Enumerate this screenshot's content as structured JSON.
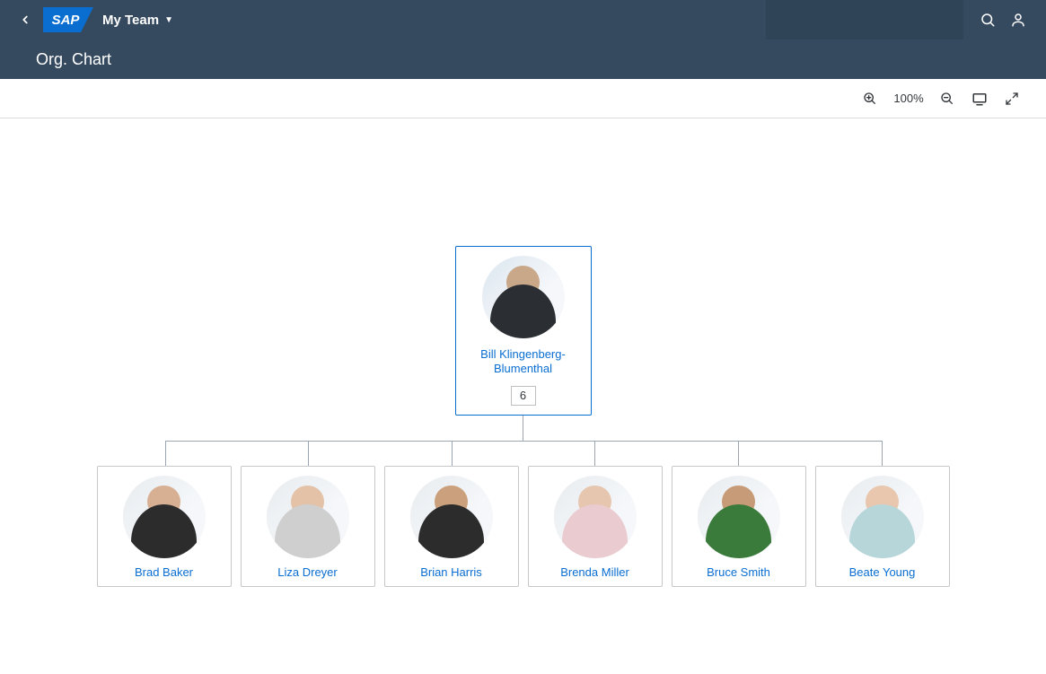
{
  "shell": {
    "logo_text": "SAP",
    "menu_label": "My Team"
  },
  "page": {
    "title": "Org. Chart"
  },
  "toolbar": {
    "zoom_level": "100%"
  },
  "org": {
    "manager": {
      "name": "Bill Klingenberg-Blumenthal",
      "direct_reports_count": "6"
    },
    "reports": [
      {
        "name": "Brad Baker"
      },
      {
        "name": "Liza Dreyer"
      },
      {
        "name": "Brian Harris"
      },
      {
        "name": "Brenda Miller"
      },
      {
        "name": "Bruce Smith"
      },
      {
        "name": "Beate Young"
      }
    ]
  }
}
